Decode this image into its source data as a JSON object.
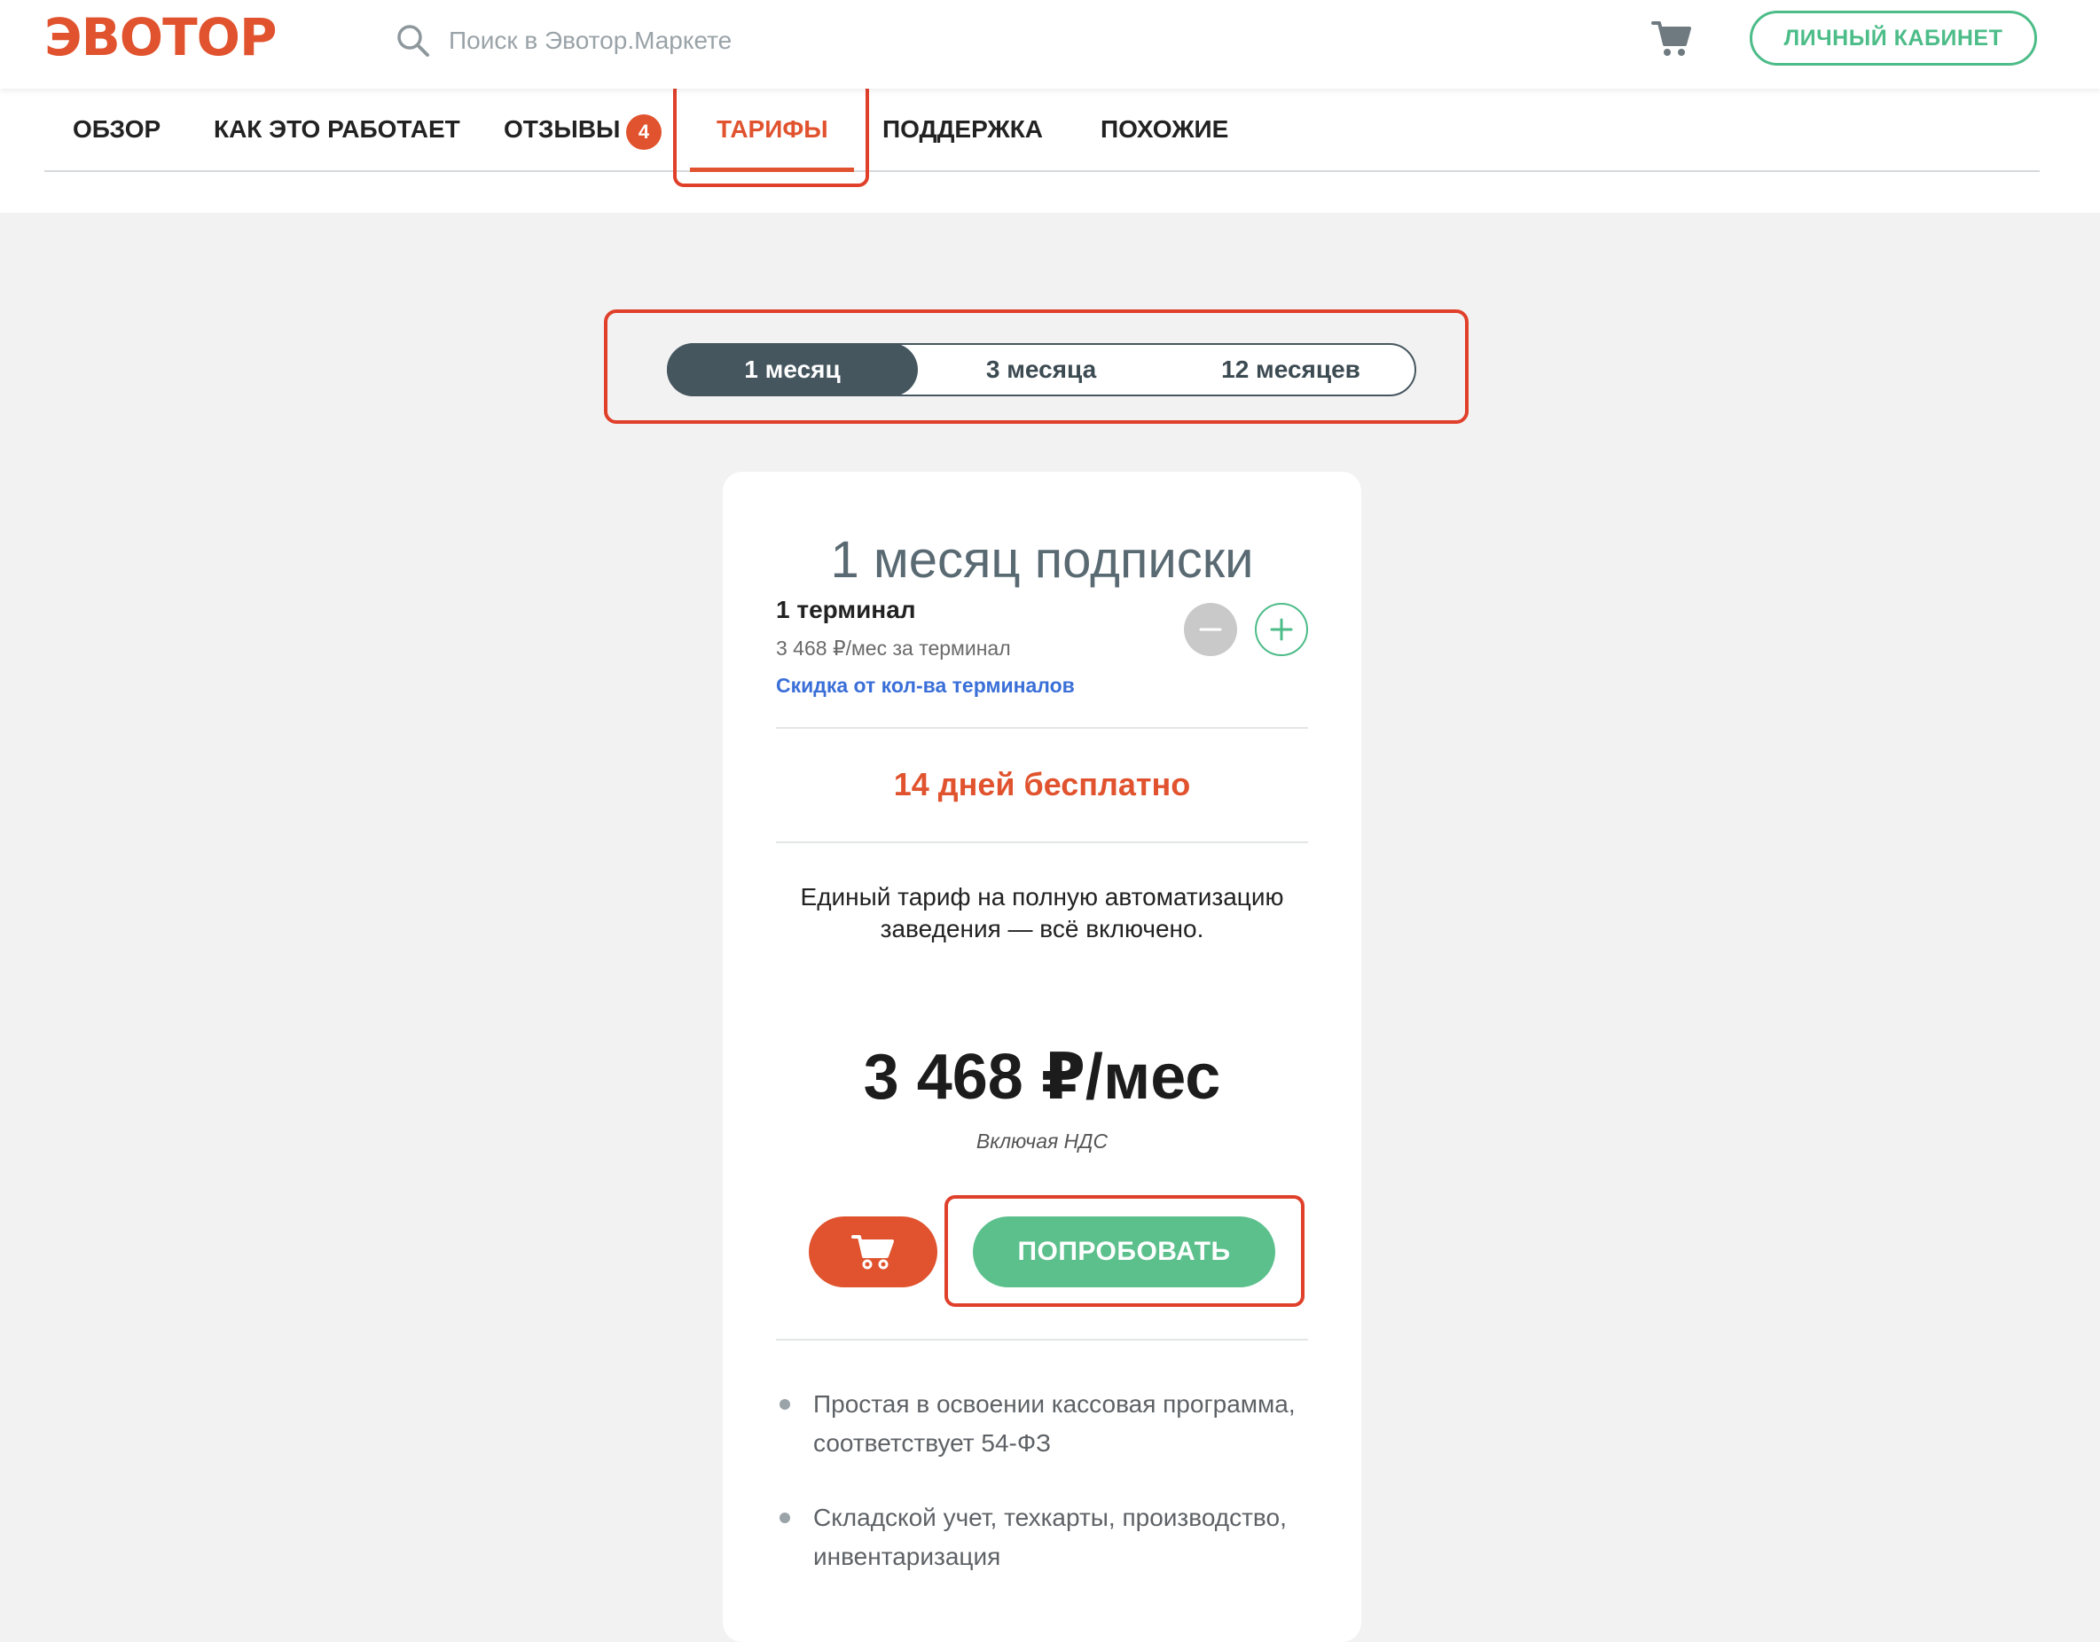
{
  "header": {
    "logo": "ЭВОТОР",
    "search_placeholder": "Поиск в Эвотор.Маркете",
    "cabinet_label": "ЛИЧНЫЙ КАБИНЕТ"
  },
  "tabs": [
    {
      "label": "ОБЗОР"
    },
    {
      "label": "КАК ЭТО РАБОТАЕТ"
    },
    {
      "label": "ОТЗЫВЫ",
      "badge": "4"
    },
    {
      "label": "ТАРИФЫ",
      "active": true
    },
    {
      "label": "ПОДДЕРЖКА"
    },
    {
      "label": "ПОХОЖИЕ"
    }
  ],
  "periods": [
    {
      "label": "1 месяц",
      "selected": true
    },
    {
      "label": "3 месяца"
    },
    {
      "label": "12 месяцев"
    }
  ],
  "plan": {
    "title": "1 месяц подписки",
    "terminals": "1 терминал",
    "price_per_terminal": "3 468 ₽/мес за терминал",
    "discount_link": "Скидка от кол-ва терминалов",
    "free_trial": "14 дней бесплатно",
    "description": "Единый тариф на полную автоматизацию заведения — всё включено.",
    "price": "3 468 ₽/мес",
    "vat_note": "Включая НДС",
    "try_label": "ПОПРОБОВАТЬ",
    "features": [
      "Простая в освоении кассовая программа, соответствует 54-ФЗ",
      "Складской учет, техкарты, производство, инвентаризация"
    ]
  },
  "colors": {
    "brand": "#e0532e",
    "accent_green": "#4cbc88",
    "switch_dark": "#46565f",
    "highlight": "#e0402a",
    "link": "#3a6fd8"
  },
  "icons": [
    "search-icon",
    "cart-icon",
    "minus-icon",
    "plus-icon",
    "cart-icon"
  ]
}
